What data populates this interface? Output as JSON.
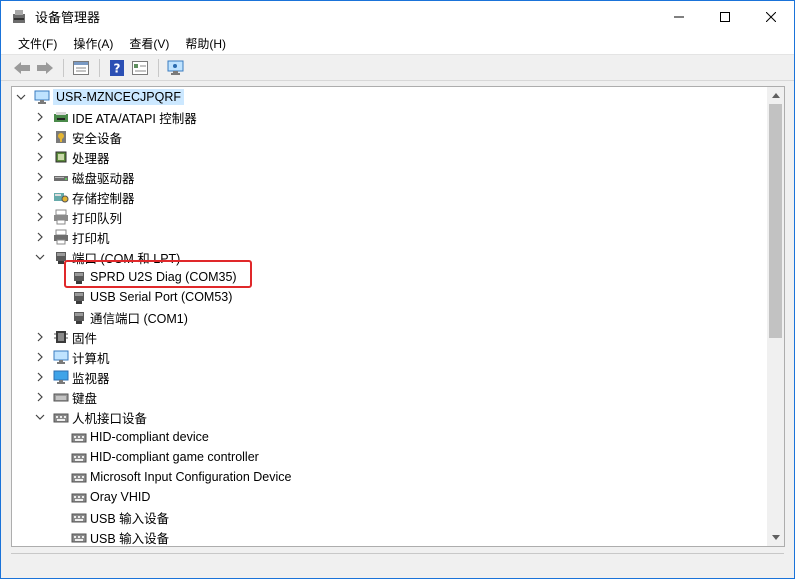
{
  "window": {
    "title": "设备管理器",
    "controls": {
      "minimize_icon": "minimize-icon",
      "maximize_icon": "maximize-icon",
      "close_icon": "close-icon"
    }
  },
  "menu": {
    "items": [
      {
        "label": "文件(F)"
      },
      {
        "label": "操作(A)"
      },
      {
        "label": "查看(V)"
      },
      {
        "label": "帮助(H)"
      }
    ]
  },
  "toolbar": {
    "buttons": [
      "back-icon",
      "forward-icon",
      "properties-icon",
      "help-icon",
      "view-icon",
      "scan-hardware-icon"
    ]
  },
  "tree": {
    "root": {
      "label": "USR-MZNCECJPQRF",
      "icon": "computer-icon"
    },
    "items": [
      {
        "label": "IDE ATA/ATAPI 控制器",
        "icon": "ide-icon",
        "expanded": false
      },
      {
        "label": "安全设备",
        "icon": "security-device-icon",
        "expanded": false
      },
      {
        "label": "处理器",
        "icon": "processor-icon",
        "expanded": false
      },
      {
        "label": "磁盘驱动器",
        "icon": "disk-drive-icon",
        "expanded": false
      },
      {
        "label": "存储控制器",
        "icon": "storage-controller-icon",
        "expanded": false
      },
      {
        "label": "打印队列",
        "icon": "print-queue-icon",
        "expanded": false
      },
      {
        "label": "打印机",
        "icon": "printer-icon",
        "expanded": false
      },
      {
        "label": "端口 (COM 和 LPT)",
        "icon": "port-icon",
        "expanded": true,
        "children": [
          {
            "label": "SPRD U2S Diag (COM35)",
            "icon": "port-icon",
            "highlighted": true
          },
          {
            "label": "USB Serial Port (COM53)",
            "icon": "port-icon"
          },
          {
            "label": "通信端口 (COM1)",
            "icon": "port-icon"
          }
        ]
      },
      {
        "label": "固件",
        "icon": "firmware-icon",
        "expanded": false
      },
      {
        "label": "计算机",
        "icon": "computer-icon",
        "expanded": false
      },
      {
        "label": "监视器",
        "icon": "monitor-icon",
        "expanded": false
      },
      {
        "label": "键盘",
        "icon": "keyboard-icon",
        "expanded": false
      },
      {
        "label": "人机接口设备",
        "icon": "hid-icon",
        "expanded": true,
        "children": [
          {
            "label": "HID-compliant device",
            "icon": "hid-icon"
          },
          {
            "label": "HID-compliant game controller",
            "icon": "hid-icon"
          },
          {
            "label": "Microsoft Input Configuration Device",
            "icon": "hid-icon"
          },
          {
            "label": "Oray VHID",
            "icon": "hid-icon"
          },
          {
            "label": "USB 输入设备",
            "icon": "hid-icon"
          },
          {
            "label": "USB 输入设备",
            "icon": "hid-icon"
          }
        ]
      }
    ]
  },
  "colors": {
    "accent": "#1a73d9",
    "selection": "#cce8ff",
    "highlight_box": "#e0282a"
  }
}
